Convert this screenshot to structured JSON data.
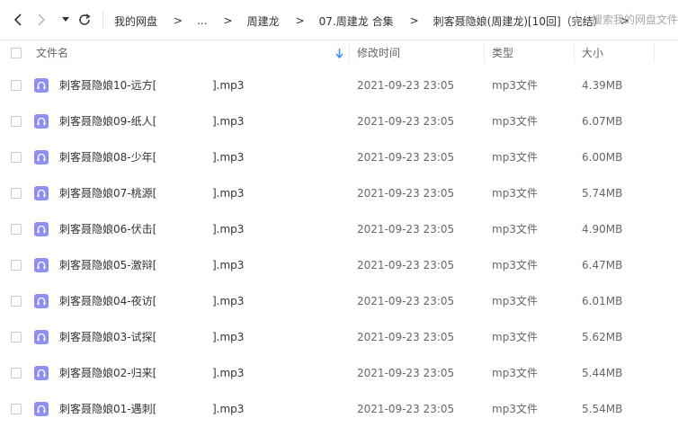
{
  "nav": {
    "back_icon": "chevron-left-icon",
    "forward_icon": "chevron-right-icon",
    "dropdown_icon": "caret-down-icon",
    "refresh_icon": "refresh-icon"
  },
  "breadcrumb": {
    "items": [
      "我的网盘",
      "...",
      "周建龙",
      "07.周建龙 合集",
      "刺客聂隐娘(周建龙)[10回]（完结）"
    ],
    "separator": ">"
  },
  "search": {
    "placeholder": "搜索我的网盘文件"
  },
  "table": {
    "columns": {
      "name": "文件名",
      "modified": "修改时间",
      "type": "类型",
      "size": "大小"
    },
    "sort_icon": "sort-down-arrow-icon",
    "rows": [
      {
        "name_prefix": "刺客聂隐娘10-远方[",
        "name_suffix": "].mp3",
        "modified": "2021-09-23 23:05",
        "type": "mp3文件",
        "size": "4.39MB"
      },
      {
        "name_prefix": "刺客聂隐娘09-纸人[",
        "name_suffix": "].mp3",
        "modified": "2021-09-23 23:05",
        "type": "mp3文件",
        "size": "6.07MB"
      },
      {
        "name_prefix": "刺客聂隐娘08-少年[",
        "name_suffix": "].mp3",
        "modified": "2021-09-23 23:05",
        "type": "mp3文件",
        "size": "6.00MB"
      },
      {
        "name_prefix": "刺客聂隐娘07-桃源[",
        "name_suffix": "].mp3",
        "modified": "2021-09-23 23:05",
        "type": "mp3文件",
        "size": "5.74MB"
      },
      {
        "name_prefix": "刺客聂隐娘06-伏击[",
        "name_suffix": "].mp3",
        "modified": "2021-09-23 23:05",
        "type": "mp3文件",
        "size": "4.90MB"
      },
      {
        "name_prefix": "刺客聂隐娘05-激辩[",
        "name_suffix": "].mp3",
        "modified": "2021-09-23 23:05",
        "type": "mp3文件",
        "size": "6.47MB"
      },
      {
        "name_prefix": "刺客聂隐娘04-夜访[",
        "name_suffix": "].mp3",
        "modified": "2021-09-23 23:05",
        "type": "mp3文件",
        "size": "6.01MB"
      },
      {
        "name_prefix": "刺客聂隐娘03-试探[",
        "name_suffix": "].mp3",
        "modified": "2021-09-23 23:05",
        "type": "mp3文件",
        "size": "5.62MB"
      },
      {
        "name_prefix": "刺客聂隐娘02-归来[",
        "name_suffix": "].mp3",
        "modified": "2021-09-23 23:05",
        "type": "mp3文件",
        "size": "5.44MB"
      },
      {
        "name_prefix": "刺客聂隐娘01-遇刺[",
        "name_suffix": "].mp3",
        "modified": "2021-09-23 23:05",
        "type": "mp3文件",
        "size": "5.54MB"
      }
    ]
  },
  "colors": {
    "audio_icon_bg": "#8f8ff0",
    "sort_arrow": "#2a8cf0",
    "text_primary": "#333333",
    "text_secondary": "#666666"
  }
}
